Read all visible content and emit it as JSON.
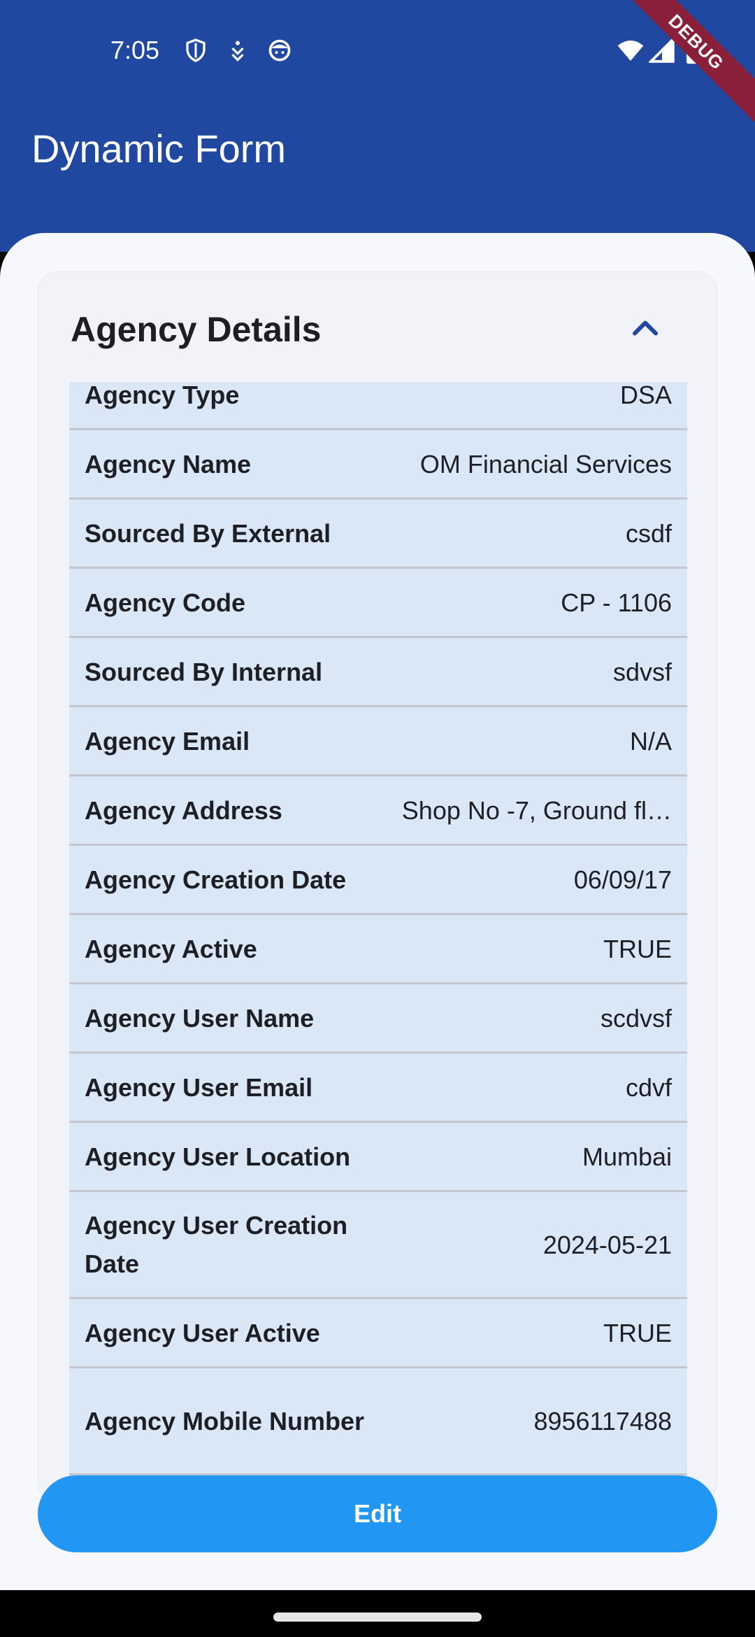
{
  "status_bar": {
    "time": "7:05",
    "left_icons": [
      "shield-icon",
      "download-icon",
      "face-icon"
    ],
    "right_icons": [
      "wifi-icon",
      "signal-icon",
      "battery-icon"
    ],
    "debug_label": "DEBUG"
  },
  "app_bar": {
    "title": "Dynamic Form"
  },
  "card": {
    "title": "Agency Details",
    "collapse_icon": "chevron-up-icon",
    "rows": [
      {
        "label": "Agency Type",
        "value": "DSA"
      },
      {
        "label": "Agency Name",
        "value": "OM Financial Services"
      },
      {
        "label": "Sourced By External",
        "value": "csdf"
      },
      {
        "label": "Agency Code",
        "value": "CP - 1106"
      },
      {
        "label": "Sourced By Internal",
        "value": "sdvsf"
      },
      {
        "label": "Agency Email",
        "value": "N/A"
      },
      {
        "label": "Agency Address",
        "value": "Shop No -7, Ground fl…"
      },
      {
        "label": "Agency Creation Date",
        "value": "06/09/17"
      },
      {
        "label": "Agency Active",
        "value": "TRUE"
      },
      {
        "label": "Agency User Name",
        "value": "scdvsf"
      },
      {
        "label": "Agency User Email",
        "value": "cdvf"
      },
      {
        "label": "Agency User Location",
        "value": "Mumbai"
      },
      {
        "label": "Agency User Creation Date",
        "value": "2024-05-21"
      },
      {
        "label": "Agency User Active",
        "value": "TRUE"
      },
      {
        "label": "Agency Mobile Number",
        "value": "8956117488"
      }
    ]
  },
  "actions": {
    "edit_label": "Edit"
  },
  "colors": {
    "app_bar": "#2148a0",
    "row_bg": "#dae7f7",
    "edit_button": "#2196f3",
    "debug_ribbon": "#8a1f3a"
  }
}
